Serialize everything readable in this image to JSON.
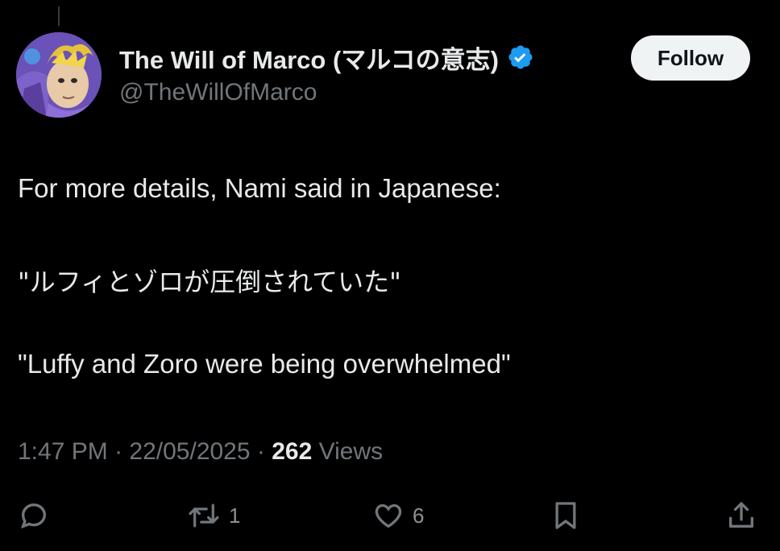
{
  "tweet": {
    "author": {
      "display_name": "The Will of Marco (マルコの意志)",
      "handle": "@TheWillOfMarco",
      "verified": true,
      "verified_color": "#1d9bf0"
    },
    "follow_label": "Follow",
    "text_lines": [
      "For more details, Nami said in Japanese:",
      "\"ルフィとゾロが圧倒されていた\"",
      "\"Luffy and Zoro were being overwhelmed\""
    ],
    "meta": {
      "time": "1:47 PM",
      "separator": " · ",
      "date": "22/05/2025",
      "views_count": "262",
      "views_label": " Views"
    },
    "actions": {
      "reply": {
        "icon": "reply-icon",
        "count": ""
      },
      "retweet": {
        "icon": "retweet-icon",
        "count": "1"
      },
      "like": {
        "icon": "heart-icon",
        "count": "6"
      },
      "bookmark": {
        "icon": "bookmark-icon",
        "count": ""
      },
      "share": {
        "icon": "share-icon",
        "count": ""
      }
    }
  },
  "colors": {
    "background": "#000000",
    "primary_text": "#e7e9ea",
    "secondary_text": "#71767b",
    "follow_bg": "#eff3f4"
  }
}
